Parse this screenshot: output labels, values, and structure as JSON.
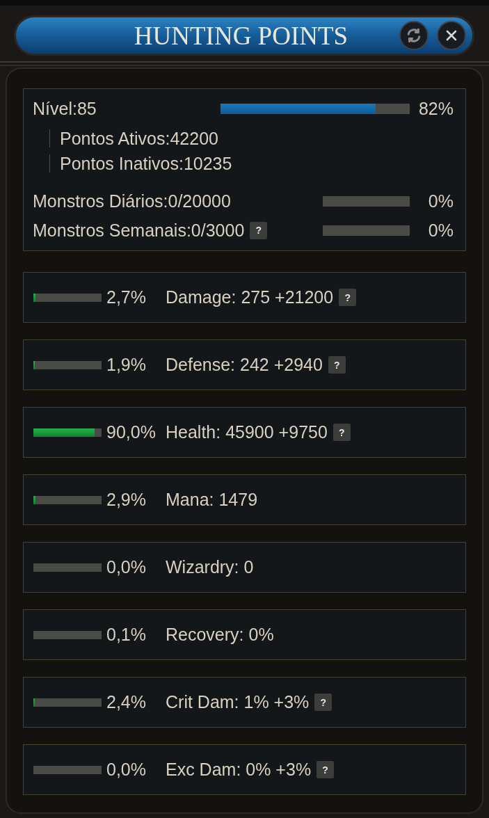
{
  "window": {
    "title": "HUNTING POINTS"
  },
  "summary": {
    "level": {
      "label": "Nível:85",
      "level": 0.82,
      "reading": "82%"
    },
    "points": [
      "Pontos Ativos:42200",
      "Pontos Inativos:10235"
    ],
    "monsters": [
      {
        "label": "Monstros Diários:0/20000",
        "level": 0,
        "reading": "0%"
      },
      {
        "label": "Monstros Semanais:0/3000",
        "help": "?",
        "level": 0,
        "reading": "0%"
      }
    ]
  },
  "stats": [
    {
      "reading": "2,7%",
      "level": 0.027,
      "label": "Damage: 275 +21200",
      "help": "?"
    },
    {
      "reading": "1,9%",
      "level": 0.019,
      "label": "Defense: 242 +2940",
      "help": "?"
    },
    {
      "reading": "90,0%",
      "level": 0.9,
      "label": "Health: 45900 +9750",
      "help": "?"
    },
    {
      "reading": "2,9%",
      "level": 0.029,
      "label": "Mana: 1479"
    },
    {
      "reading": "0,0%",
      "level": 0,
      "label": "Wizardry: 0"
    },
    {
      "reading": "0,1%",
      "level": 0.001,
      "label": "Recovery: 0%"
    },
    {
      "reading": "2,4%",
      "level": 0.024,
      "label": "Crit Dam: 1% +3%",
      "help": "?"
    },
    {
      "reading": "0,0%",
      "level": 0,
      "label": "Exc Dam: 0% +3%",
      "help": "?"
    }
  ]
}
